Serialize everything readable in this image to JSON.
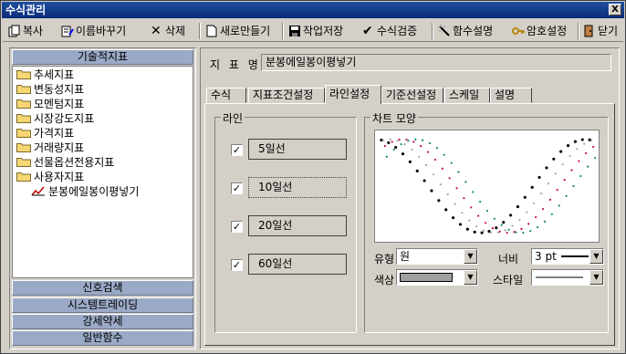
{
  "window": {
    "title": "수식관리",
    "close_label": "X"
  },
  "toolbar": {
    "copy": "복사",
    "rename": "이름바꾸기",
    "delete": "삭제",
    "new": "새로만들기",
    "save": "작업저장",
    "verify": "수식검증",
    "func_desc": "함수설명",
    "password": "암호설정",
    "close": "닫기"
  },
  "left": {
    "header": "기술적지표",
    "tree": [
      "추세지표",
      "변동성지표",
      "모멘텀지표",
      "시장강도지표",
      "가격지표",
      "거래량지표",
      "선물옵션전용지표",
      "사용자지표"
    ],
    "selected_item": "분봉에일봉이평넣기",
    "bottom_headers": [
      "신호검색",
      "시스템트레이딩",
      "강세약세",
      "일반함수"
    ]
  },
  "right": {
    "name_label": "지 표 명",
    "name_value": "분봉에일봉이평넣기",
    "tabs": [
      "수식",
      "지표조건설정",
      "라인설정",
      "기준선설정",
      "스케일",
      "설명"
    ],
    "active_tab": "라인설정",
    "line_group": {
      "title": "라인",
      "lines": [
        {
          "label": "5일선",
          "checked": true
        },
        {
          "label": "10일선",
          "checked": true
        },
        {
          "label": "20일선",
          "checked": true
        },
        {
          "label": "60일선",
          "checked": true
        }
      ]
    },
    "chart_group": {
      "title": "차트 모양",
      "type_label": "유형",
      "type_value": "원",
      "width_label": "너비",
      "width_value": "3 pt",
      "color_label": "색상",
      "color_value": "#a0a0a0",
      "style_label": "스타일"
    }
  }
}
